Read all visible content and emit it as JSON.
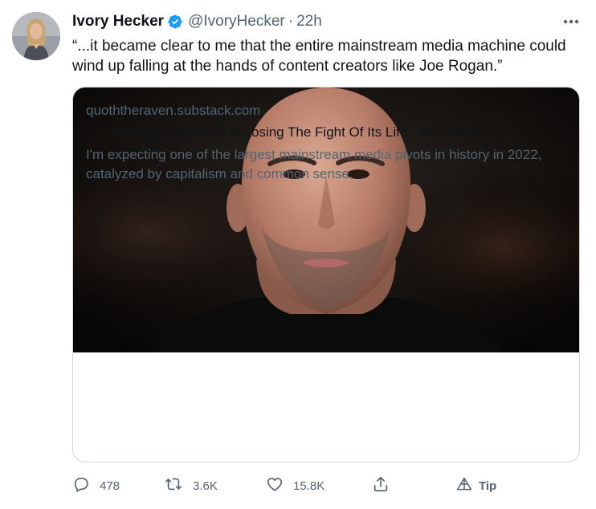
{
  "author": {
    "display_name": "Ivory Hecker",
    "handle": "@IvoryHecker",
    "separator": "·",
    "time": "22h",
    "verified": true
  },
  "tweet_text": "“...it became clear to me that the entire mainstream media machine could wind up falling at the hands of content creators like Joe Rogan.”",
  "link_card": {
    "domain": "quoththeraven.substack.com",
    "title": "The Mainstream Media Is Losing The Fight Of Its Life...All Thanks To J...",
    "description": "I'm expecting one of the largest mainstream media pivots in history in 2022, catalyzed by capitalism and common sense."
  },
  "actions": {
    "replies": "478",
    "retweets": "3.6K",
    "likes": "15.8K",
    "tip_label": "Tip"
  },
  "icons": {
    "more": "more-icon",
    "verified": "verified-badge-icon",
    "reply": "reply-icon",
    "retweet": "retweet-icon",
    "like": "heart-icon",
    "share": "share-icon",
    "tip": "tip-icon"
  },
  "colors": {
    "verified_blue": "#1d9bf0",
    "text_primary": "#0f1419",
    "text_secondary": "#536471",
    "card_border": "#cfd9de"
  }
}
